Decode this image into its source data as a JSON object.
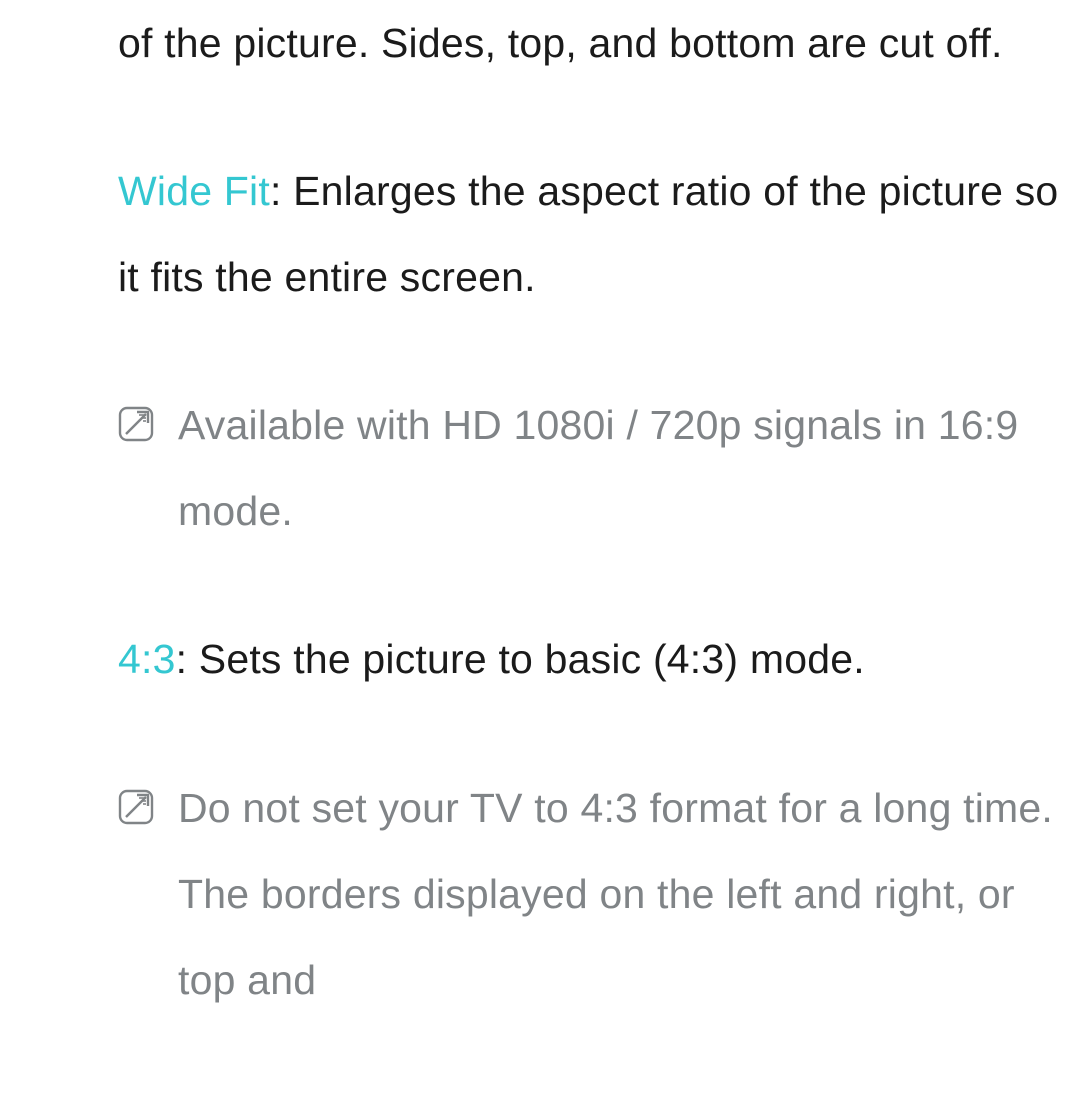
{
  "paragraphs": {
    "prev_tail": "of the picture. Sides, top, and bottom are cut off.",
    "wide_fit": {
      "term": "Wide Fit",
      "desc": ": Enlarges the aspect ratio of the picture so it fits the entire screen."
    },
    "note1": "Available with HD 1080i / 720p signals in 16:9 mode.",
    "ratio43": {
      "term": "4:3",
      "desc": ": Sets the picture to basic (4:3) mode."
    },
    "note2": "Do not set your TV to 4:3 format for a long time. The borders displayed on the left and right, or top and"
  }
}
